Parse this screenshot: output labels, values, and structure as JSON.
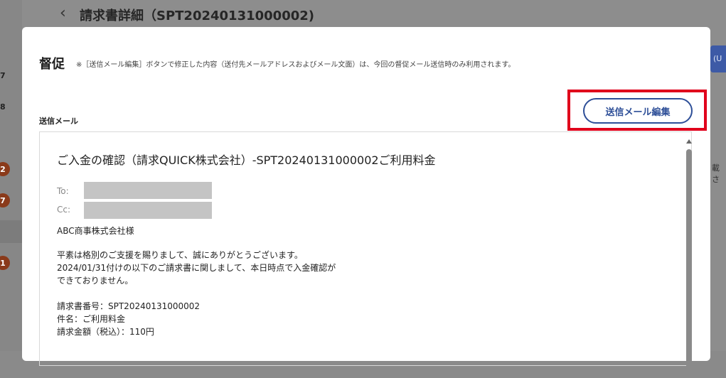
{
  "background": {
    "page_title": "請求書詳細（SPT20240131000002)",
    "sidebar_numbers": [
      "7",
      "8"
    ],
    "sidebar_badges": [
      "2",
      "7",
      "1"
    ],
    "right_button_fragment": "(U",
    "right_text_fragment": "載さ"
  },
  "modal": {
    "title": "督促",
    "note": "※［送信メール編集］ボタンで修正した内容（送付先メールアドレスおよびメール文面）は、今回の督促メール送信時のみ利用されます。",
    "section_label": "送信メール",
    "edit_button_label": "送信メール編集",
    "mail": {
      "subject": "ご入金の確認（請求QUICK株式会社）-SPT20240131000002ご利用料金",
      "to_label": "To:",
      "cc_label": "Cc:",
      "recipient": "ABC商事株式会社様",
      "body_1": "平素は格別のご支援を賜りまして、誠にありがとうございます。",
      "body_2": "2024/01/31付けの以下のご請求書に関しまして、本日時点で入金確認が",
      "body_3": "できておりません。",
      "invoice_number": "請求書番号：SPT20240131000002",
      "subject_line": "件名：ご利用料金",
      "amount": "請求金額（税込）：110円"
    }
  },
  "colors": {
    "accent": "#2e4f98",
    "highlight": "#e0001b",
    "redacted": "#c4c4c4"
  }
}
